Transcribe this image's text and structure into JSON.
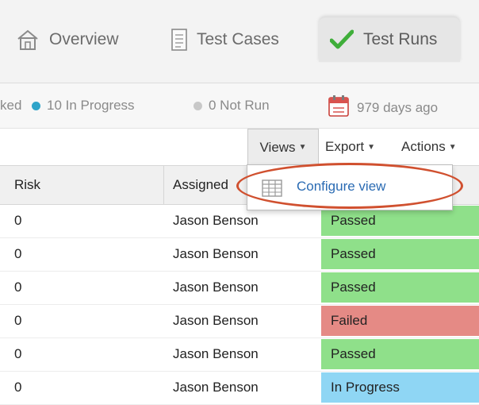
{
  "tabs": {
    "overview": "Overview",
    "test_cases": "Test Cases",
    "test_runs": "Test Runs"
  },
  "status": {
    "blocked": "ked",
    "in_progress": "10 In Progress",
    "not_run": "0 Not Run",
    "age": "979 days ago"
  },
  "toolbar": {
    "views": "Views",
    "export": "Export",
    "actions": "Actions"
  },
  "dropdown": {
    "configure_view": "Configure view"
  },
  "table": {
    "headers": {
      "risk": "Risk",
      "assigned": "Assigned"
    },
    "rows": [
      {
        "risk": "0",
        "assigned": "Jason Benson",
        "status": "Passed"
      },
      {
        "risk": "0",
        "assigned": "Jason Benson",
        "status": "Passed"
      },
      {
        "risk": "0",
        "assigned": "Jason Benson",
        "status": "Passed"
      },
      {
        "risk": "0",
        "assigned": "Jason Benson",
        "status": "Failed"
      },
      {
        "risk": "0",
        "assigned": "Jason Benson",
        "status": "Passed"
      },
      {
        "risk": "0",
        "assigned": "Jason Benson",
        "status": "In Progress"
      }
    ]
  },
  "colors": {
    "passed": "#8fe08a",
    "failed": "#e58a85",
    "in_progress": "#8fd6f4",
    "highlight": "#d0502f",
    "link": "#2a6bb3"
  }
}
